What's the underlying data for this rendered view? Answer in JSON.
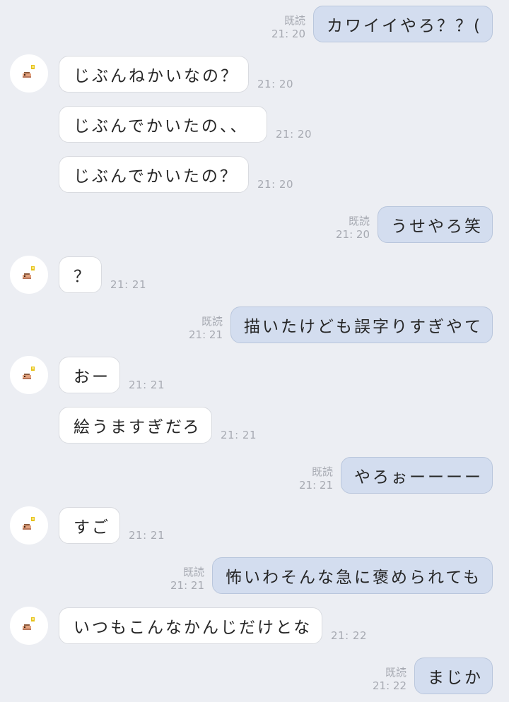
{
  "colors": {
    "background": "#eceef3",
    "incoming_bubble": "#ffffff",
    "outgoing_bubble": "#d3ddef",
    "meta_text": "#a7aab2"
  },
  "icons": {
    "avatar": "pixel-character-icon"
  },
  "messages": [
    {
      "direction": "out",
      "text": "カワイイやろ？？(",
      "read": "既読",
      "time": "21: 20"
    },
    {
      "direction": "in",
      "text": "じぶんねかいなの？",
      "time": "21: 20"
    },
    {
      "direction": "in",
      "text": "じぶんでかいたの、、",
      "time": "21: 20"
    },
    {
      "direction": "in",
      "text": "じぶんでかいたの？",
      "time": "21: 20"
    },
    {
      "direction": "out",
      "text": "うせやろ笑",
      "read": "既読",
      "time": "21: 20"
    },
    {
      "direction": "in",
      "text": "？",
      "time": "21: 21"
    },
    {
      "direction": "out",
      "text": "描いたけども誤字りすぎやて",
      "read": "既読",
      "time": "21: 21"
    },
    {
      "direction": "in",
      "text": "おー",
      "time": "21: 21"
    },
    {
      "direction": "in",
      "text": "絵うますぎだろ",
      "time": "21: 21"
    },
    {
      "direction": "out",
      "text": "やろぉーーーー",
      "read": "既読",
      "time": "21: 21"
    },
    {
      "direction": "in",
      "text": "すご",
      "time": "21: 21"
    },
    {
      "direction": "out",
      "text": "怖いわそんな急に褒められても",
      "read": "既読",
      "time": "21: 21"
    },
    {
      "direction": "in",
      "text": "いつもこんなかんじだけとな",
      "time": "21: 22"
    },
    {
      "direction": "out",
      "text": "まじか",
      "read": "既読",
      "time": "21: 22"
    }
  ]
}
